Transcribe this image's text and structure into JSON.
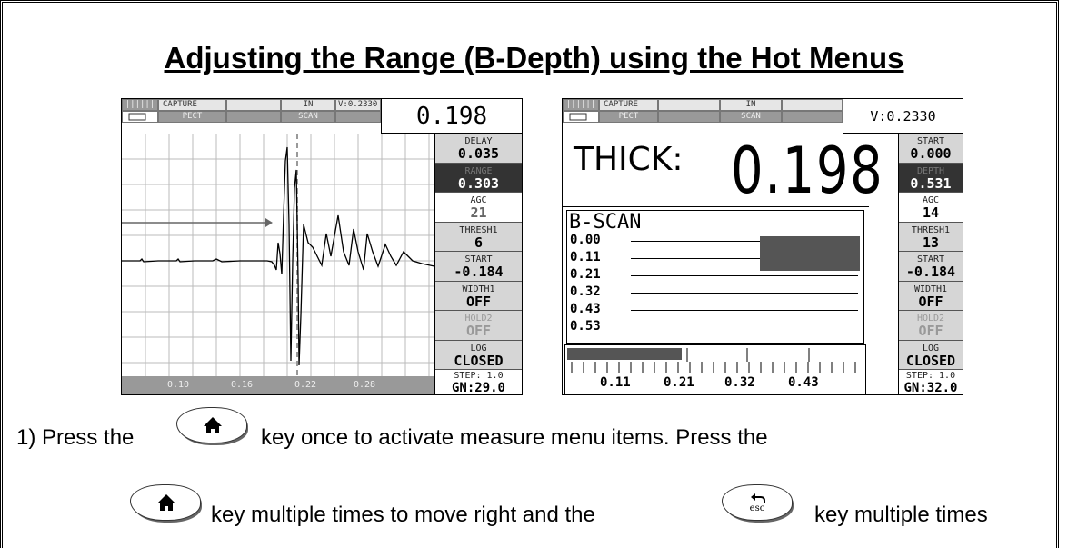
{
  "title": "Adjusting the Range (B-Depth) using the Hot Menus",
  "screen1": {
    "header": {
      "capture": "CAPTURE",
      "units": "IN",
      "velocity": "V:0.2330",
      "pect": "PECT",
      "scan": "SCAN"
    },
    "reading": "0.198",
    "menu": [
      {
        "label": "DELAY",
        "value": "0.035",
        "state": "normal"
      },
      {
        "label": "RANGE",
        "value": "0.303",
        "state": "selected"
      },
      {
        "label": "AGC",
        "value": "21",
        "state": "light"
      },
      {
        "label": "THRESH1",
        "value": "6",
        "state": "normal"
      },
      {
        "label": "START",
        "value": "-0.184",
        "state": "normal"
      },
      {
        "label": "WIDTH1",
        "value": "OFF",
        "state": "normal"
      },
      {
        "label": "HOLD2",
        "value": "OFF",
        "state": "dim"
      },
      {
        "label": "LOG",
        "value": "CLOSED",
        "state": "normal"
      }
    ],
    "step": "STEP: 1.0",
    "gain": "GN:29.0",
    "x_ticks": [
      "0.10",
      "0.16",
      "0.22",
      "0.28"
    ]
  },
  "screen2": {
    "header": {
      "capture": "CAPTURE",
      "units": "IN",
      "velocity": "V:0.2330",
      "pect": "PECT",
      "scan": "SCAN"
    },
    "thick_label": "THICK:",
    "thick_value": "0.198",
    "menu": [
      {
        "label": "START",
        "value": "0.000",
        "state": "normal"
      },
      {
        "label": "DEPTH",
        "value": "0.531",
        "state": "selected"
      },
      {
        "label": "AGC",
        "value": "14",
        "state": "light"
      },
      {
        "label": "THRESH1",
        "value": "13",
        "state": "normal"
      },
      {
        "label": "START",
        "value": "-0.184",
        "state": "normal"
      },
      {
        "label": "WIDTH1",
        "value": "OFF",
        "state": "normal"
      },
      {
        "label": "HOLD2",
        "value": "OFF",
        "state": "dim"
      },
      {
        "label": "LOG",
        "value": "CLOSED",
        "state": "normal"
      }
    ],
    "step": "STEP: 1.0",
    "gain": "GN:32.0",
    "bscan_title": "B-SCAN",
    "depths": [
      "0.00",
      "0.11",
      "0.21",
      "0.32",
      "0.43",
      "0.53"
    ],
    "ruler_labels": [
      "0.11",
      "0.21",
      "0.32",
      "0.43"
    ]
  },
  "instructions": {
    "line1_a": "1)  Press the",
    "line1_b": "key once to activate measure menu items.  Press the",
    "line2_a": "key multiple times to move right and the",
    "line2_b": "key multiple times"
  },
  "keys": {
    "home": "home-key",
    "esc_label": "esc"
  }
}
